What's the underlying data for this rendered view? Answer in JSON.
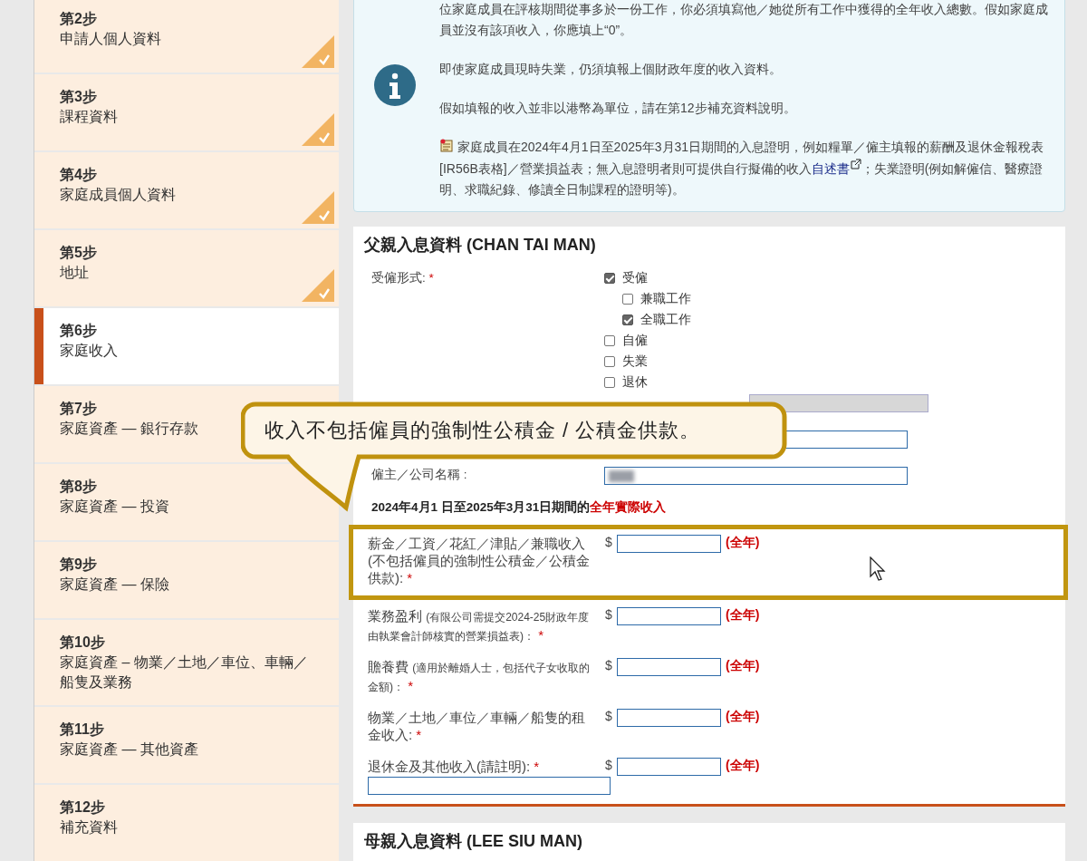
{
  "sidebar": {
    "steps": [
      {
        "step": "第2步",
        "title": "申請人個人資料",
        "completed": true,
        "selected": false
      },
      {
        "step": "第3步",
        "title": "課程資料",
        "completed": true,
        "selected": false
      },
      {
        "step": "第4步",
        "title": "家庭成員個人資料",
        "completed": true,
        "selected": false
      },
      {
        "step": "第5步",
        "title": "地址",
        "completed": true,
        "selected": false
      },
      {
        "step": "第6步",
        "title": "家庭收入",
        "completed": false,
        "selected": true
      },
      {
        "step": "第7步",
        "title": "家庭資產 — 銀行存款",
        "completed": false,
        "selected": false
      },
      {
        "step": "第8步",
        "title": "家庭資產 — 投資",
        "completed": false,
        "selected": false
      },
      {
        "step": "第9步",
        "title": "家庭資產 — 保險",
        "completed": false,
        "selected": false
      },
      {
        "step": "第10步",
        "title": "家庭資產 – 物業／土地／車位、車輛／船隻及業務",
        "completed": false,
        "selected": false
      },
      {
        "step": "第11步",
        "title": "家庭資產 — 其他資產",
        "completed": false,
        "selected": false
      },
      {
        "step": "第12步",
        "title": "補充資料",
        "completed": false,
        "selected": false
      }
    ]
  },
  "info": {
    "paragraphs": [
      "位家庭成員在評核期間從事多於一份工作，你必須填寫他／她從所有工作中獲得的全年收入總數。假如家庭成員並沒有該項收入，你應填上“0”。",
      "即使家庭成員現時失業，仍須填報上個財政年度的收入資料。",
      "假如填報的收入並非以港幣為單位，請在第12步補充資料說明。"
    ],
    "proof": {
      "before": "家庭成員在2024年4月1日至2025年3月31日期間的入息證明，例如糧單／僱主填報的薪酬及退休金報稅表[IR56B表格]／營業損益表；無入息證明者則可提供自行擬備的收入",
      "link": "自述書",
      "after": "；失業證明(例如解僱信、醫療證明、求職紀錄、修讀全日制課程的證明等)。"
    }
  },
  "father": {
    "title": "父親入息資料 (CHAN TAI MAN)",
    "employment": {
      "label": "受僱形式:",
      "required_mark": "*",
      "options": [
        {
          "label": "受僱",
          "checked": true,
          "children": [
            {
              "label": "兼職工作",
              "checked": false
            },
            {
              "label": "全職工作",
              "checked": true
            }
          ]
        },
        {
          "label": "自僱",
          "checked": false
        },
        {
          "label": "失業",
          "checked": false
        },
        {
          "label": "退休",
          "checked": false
        }
      ]
    },
    "other_field": {
      "disabled": true
    },
    "employer": {
      "label": "僱主／公司名稱 :",
      "blurred": true
    },
    "period": {
      "text": "2024年4月1 日至2025年3月31日期間的",
      "emphasis": "全年實際收入"
    },
    "income_rows": [
      {
        "label": "薪金／工資／花紅／津貼／兼職收入 (不包括僱員的強制性公積金／公積金供款):",
        "required_mark": "*",
        "currency": "$",
        "suffix": "(全年)",
        "highlighted": true
      },
      {
        "label": "業務盈利",
        "note": "(有限公司需提交2024-25財政年度由執業會計師核實的營業損益表)：",
        "required_mark": "*",
        "currency": "$",
        "suffix": "(全年)",
        "highlighted": false
      },
      {
        "label": "贍養費",
        "note": "(適用於離婚人士，包括代子女收取的金額)：",
        "required_mark": "*",
        "currency": "$",
        "suffix": "(全年)",
        "highlighted": false
      },
      {
        "label": "物業／土地／車位／車輛／船隻的租金收入:",
        "required_mark": "*",
        "currency": "$",
        "suffix": "(全年)",
        "highlighted": false
      },
      {
        "label": "退休金及其他收入(請註明):",
        "required_mark": "*",
        "currency": "$",
        "suffix": "(全年)",
        "highlighted": false,
        "extra_field": true
      }
    ]
  },
  "callout": {
    "text": "收入不包括僱員的強制性公積金 / 公積金供款。"
  },
  "mother": {
    "title": "母親入息資料 (LEE SIU MAN)"
  }
}
